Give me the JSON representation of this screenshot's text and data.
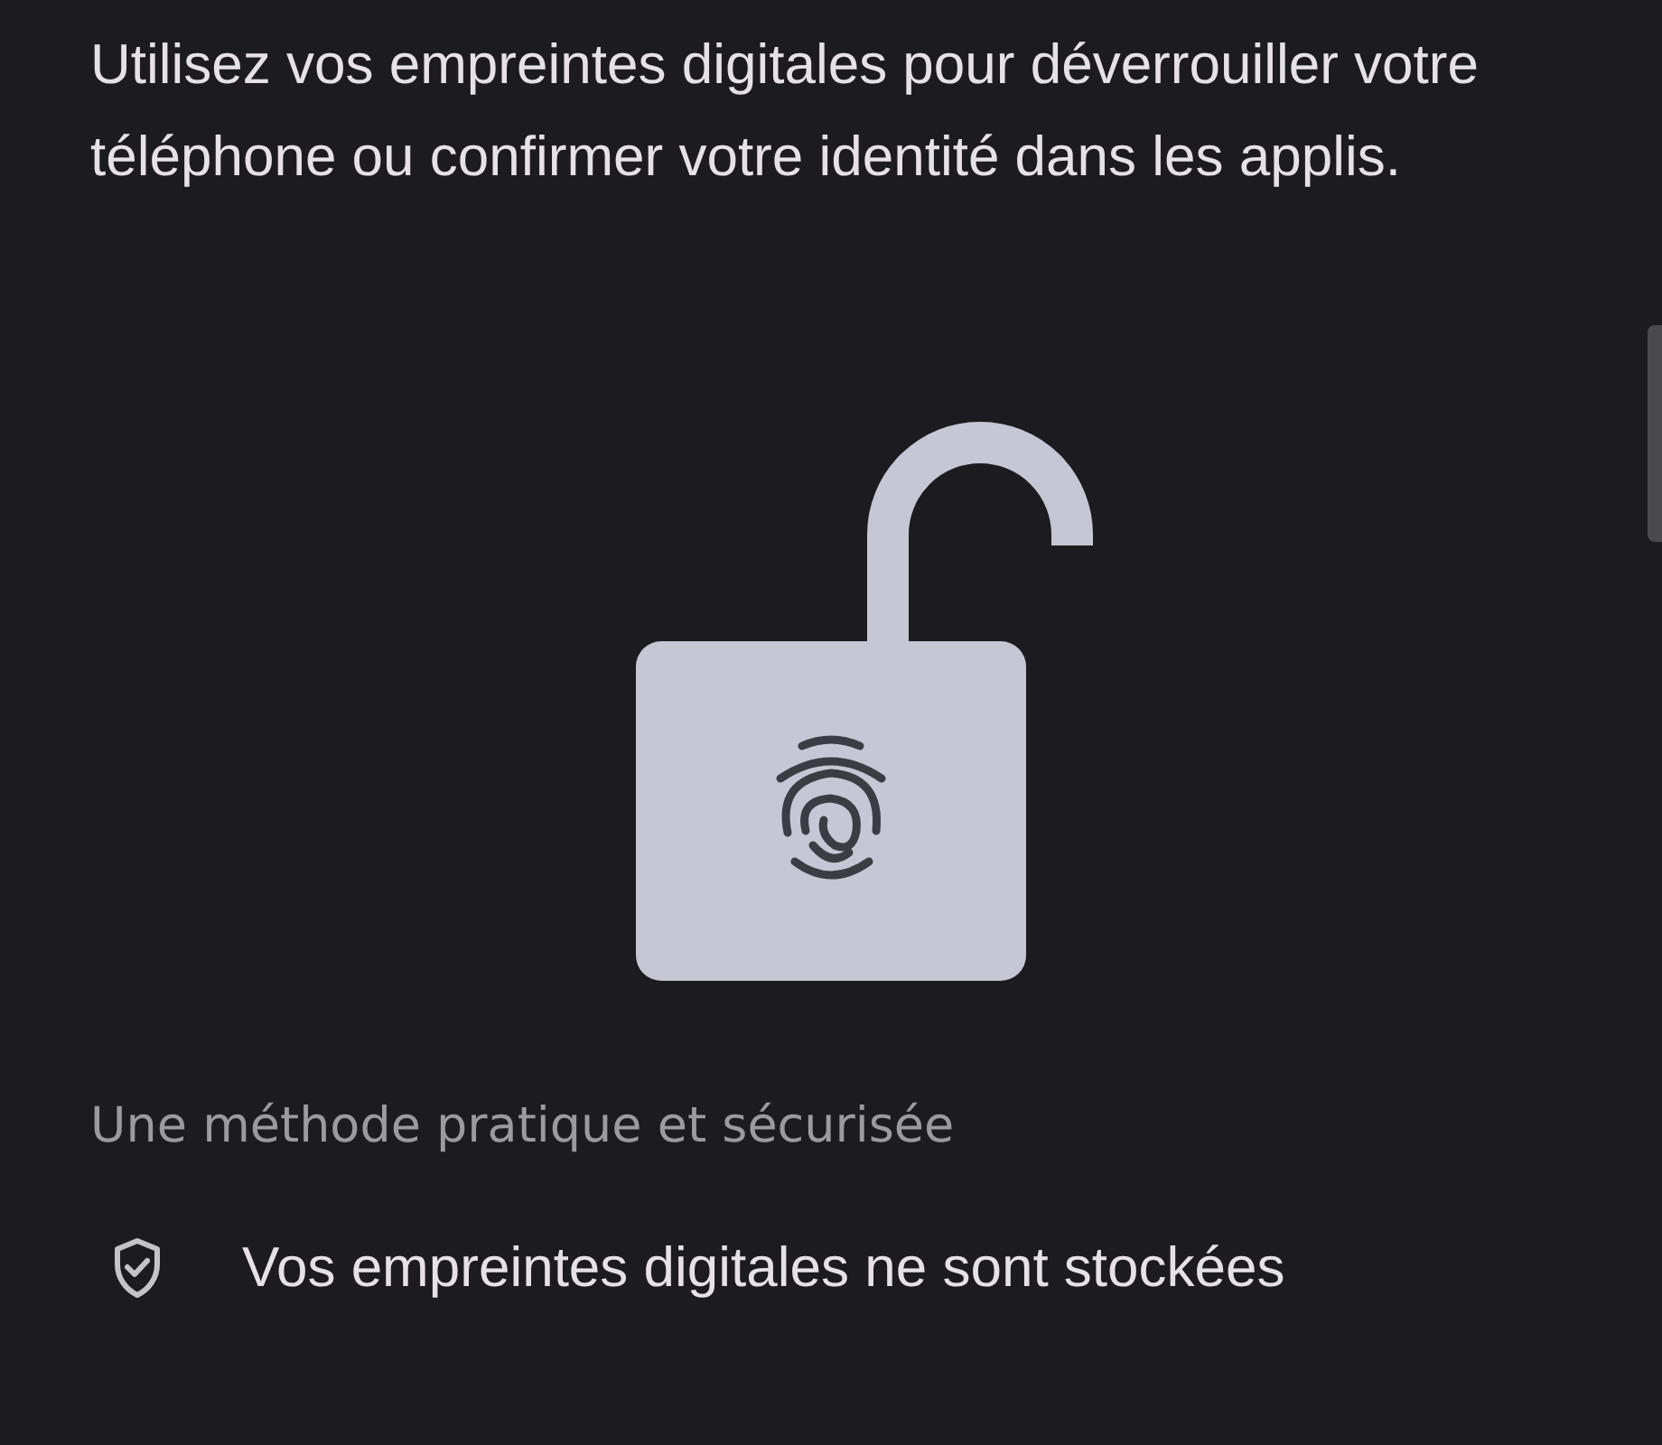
{
  "intro": "Utilisez vos empreintes digitales pour déverrouiller votre téléphone ou confirmer votre identité dans les applis.",
  "section_title": "Une méthode pratique et sécurisée",
  "points": [
    {
      "kind": "shield",
      "text": "Vos empreintes digitales ne sont stockées"
    }
  ]
}
